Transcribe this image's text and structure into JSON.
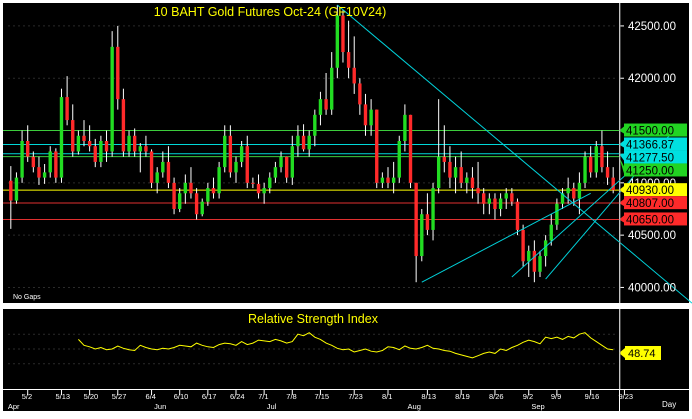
{
  "chart_data": [
    {
      "type": "candlestick",
      "title": "10 BAHT Gold Futures Oct-24 (GF10V24)",
      "note": "No Gaps",
      "y_ticks": [
        40000,
        40500,
        41000,
        41500,
        42000,
        42500
      ],
      "y_tick_labels": [
        "40000.00",
        "40500.00",
        "41000.00",
        "41500.00",
        "42000.00",
        "42500.00"
      ],
      "ylim": [
        39880,
        42700
      ],
      "x_tick_labels": [
        "5/2",
        "5/13",
        "5/20",
        "5/27",
        "6/4",
        "6/10",
        "6/17",
        "6/24",
        "7/1",
        "7/8",
        "7/15",
        "7/23",
        "8/1",
        "8/13",
        "8/19",
        "8/26",
        "9/2",
        "9/9",
        "9/16",
        "9/23"
      ],
      "month_labels": [
        "Apr",
        "Jun",
        "Jul",
        "Aug",
        "Sep"
      ],
      "axis_label": "Day",
      "horizontal_levels": [
        {
          "value": 41500,
          "label": "41500.00",
          "color": "#3ccc3c",
          "label_bg": "#22d422"
        },
        {
          "value": 41366.87,
          "label": "41366.87",
          "color": "#00d8d8",
          "label_bg": "#00e0e0"
        },
        {
          "value": 41277.5,
          "label": "41277.50",
          "color": "#00d8d8",
          "label_bg": "#00e0e0"
        },
        {
          "value": 41250,
          "label": "41250.00",
          "color": "#3ccc3c",
          "label_bg": "#22d422"
        },
        {
          "value": 40930,
          "label": "40930.00",
          "color": "#ffff00",
          "label_bg": "#ffff00"
        },
        {
          "value": 40807,
          "label": "40807.00",
          "color": "#e03030",
          "label_bg": "#ff2a2a"
        },
        {
          "value": 40650,
          "label": "40650.00",
          "color": "#e03030",
          "label_bg": "#ff2a2a"
        }
      ],
      "candles": [
        [
          41020,
          41160,
          40560,
          40830
        ],
        [
          40830,
          41100,
          40800,
          41050
        ],
        [
          41050,
          41500,
          41000,
          41400
        ],
        [
          41400,
          41550,
          41200,
          41250
        ],
        [
          41250,
          41300,
          41100,
          41150
        ],
        [
          41150,
          41250,
          40980,
          41050
        ],
        [
          41050,
          41180,
          40990,
          41100
        ],
        [
          41100,
          41350,
          41050,
          41300
        ],
        [
          41300,
          41330,
          41000,
          41050
        ],
        [
          41050,
          41900,
          41000,
          41820
        ],
        [
          41820,
          42020,
          41550,
          41600
        ],
        [
          41600,
          41750,
          41250,
          41300
        ],
        [
          41300,
          41500,
          41270,
          41450
        ],
        [
          41450,
          41600,
          41350,
          41400
        ],
        [
          41400,
          41550,
          41300,
          41350
        ],
        [
          41350,
          41420,
          41150,
          41200
        ],
        [
          41200,
          41450,
          41150,
          41400
        ],
        [
          41400,
          41500,
          41200,
          41300
        ],
        [
          41300,
          42450,
          41250,
          42300
        ],
        [
          42300,
          42500,
          41700,
          41800
        ],
        [
          41800,
          41900,
          41250,
          41300
        ],
        [
          41300,
          41500,
          41250,
          41450
        ],
        [
          41450,
          41520,
          41250,
          41300
        ],
        [
          41300,
          41380,
          41100,
          41350
        ],
        [
          41350,
          41450,
          41250,
          41300
        ],
        [
          41300,
          41320,
          40950,
          41000
        ],
        [
          41000,
          41150,
          40900,
          41100
        ],
        [
          41100,
          41300,
          41050,
          41200
        ],
        [
          41200,
          41350,
          40950,
          41000
        ],
        [
          41000,
          41050,
          40700,
          40750
        ],
        [
          40750,
          40950,
          40720,
          40900
        ],
        [
          40900,
          41080,
          40800,
          41000
        ],
        [
          41000,
          41150,
          40850,
          40900
        ],
        [
          40900,
          40950,
          40650,
          40700
        ],
        [
          40700,
          40850,
          40680,
          40820
        ],
        [
          40820,
          41000,
          40780,
          40950
        ],
        [
          40950,
          41050,
          40850,
          40900
        ],
        [
          40900,
          41200,
          40850,
          41150
        ],
        [
          41150,
          41550,
          41100,
          41450
        ],
        [
          41450,
          41550,
          41050,
          41100
        ],
        [
          41100,
          41250,
          41000,
          41200
        ],
        [
          41200,
          41400,
          41150,
          41350
        ],
        [
          41350,
          41450,
          40950,
          41000
        ],
        [
          41000,
          41050,
          40950,
          40990
        ],
        [
          40990,
          41080,
          40850,
          40900
        ],
        [
          40900,
          41000,
          40800,
          40950
        ],
        [
          40950,
          41100,
          40900,
          41050
        ],
        [
          41050,
          41200,
          41000,
          41150
        ],
        [
          41150,
          41300,
          41100,
          41250
        ],
        [
          41250,
          41250,
          41000,
          41050
        ],
        [
          41050,
          41450,
          40980,
          41350
        ],
        [
          41350,
          41550,
          41250,
          41450
        ],
        [
          41450,
          41560,
          41300,
          41320
        ],
        [
          41320,
          41500,
          41250,
          41450
        ],
        [
          41450,
          41700,
          41350,
          41650
        ],
        [
          41650,
          41870,
          41550,
          41800
        ],
        [
          41800,
          42050,
          41650,
          41700
        ],
        [
          41700,
          42250,
          41650,
          42100
        ],
        [
          42100,
          42700,
          42000,
          42600
        ],
        [
          42600,
          42650,
          42150,
          42250
        ],
        [
          42250,
          42550,
          42000,
          42100
        ],
        [
          42100,
          42400,
          41850,
          41950
        ],
        [
          41950,
          42000,
          41650,
          41750
        ],
        [
          41750,
          41850,
          41450,
          41550
        ],
        [
          41550,
          41800,
          41450,
          41700
        ],
        [
          41700,
          41700,
          40950,
          41000
        ],
        [
          41000,
          41100,
          40950,
          41050
        ],
        [
          41050,
          41150,
          40950,
          41000
        ],
        [
          41000,
          41200,
          40900,
          41050
        ],
        [
          41050,
          41450,
          41000,
          41400
        ],
        [
          41400,
          41750,
          41300,
          41650
        ],
        [
          41650,
          41650,
          40950,
          41000
        ],
        [
          41000,
          41000,
          40050,
          40300
        ],
        [
          40300,
          40750,
          40250,
          40700
        ],
        [
          40700,
          40900,
          40500,
          40550
        ],
        [
          40550,
          41000,
          40450,
          40950
        ],
        [
          40950,
          41800,
          40900,
          41250
        ],
        [
          41250,
          41550,
          41100,
          41200
        ],
        [
          41200,
          41350,
          40950,
          41050
        ],
        [
          41050,
          41250,
          40900,
          41150
        ],
        [
          41150,
          41300,
          40950,
          41000
        ],
        [
          41000,
          41100,
          40900,
          41050
        ],
        [
          41050,
          41150,
          40850,
          40950
        ],
        [
          40950,
          41200,
          40800,
          40900
        ],
        [
          40900,
          40950,
          40700,
          40800
        ],
        [
          40800,
          40900,
          40700,
          40850
        ],
        [
          40850,
          40900,
          40650,
          40750
        ],
        [
          40750,
          40900,
          40680,
          40850
        ],
        [
          40850,
          40950,
          40750,
          40900
        ],
        [
          40900,
          40950,
          40780,
          40820
        ],
        [
          40820,
          40850,
          40500,
          40550
        ],
        [
          40550,
          40600,
          40200,
          40250
        ],
        [
          40250,
          40400,
          40100,
          40350
        ],
        [
          40350,
          40450,
          40050,
          40150
        ],
        [
          40150,
          40350,
          40100,
          40300
        ],
        [
          40300,
          40500,
          40200,
          40450
        ],
        [
          40450,
          40700,
          40400,
          40600
        ],
        [
          40600,
          40850,
          40550,
          40800
        ],
        [
          40800,
          40950,
          40750,
          40900
        ],
        [
          40900,
          41050,
          40800,
          40950
        ],
        [
          40950,
          41000,
          40780,
          40850
        ],
        [
          40850,
          41100,
          40700,
          41000
        ],
        [
          41000,
          41300,
          40950,
          41250
        ],
        [
          41250,
          41350,
          41050,
          41100
        ],
        [
          41100,
          41400,
          41050,
          41350
        ],
        [
          41350,
          41500,
          41100,
          41150
        ],
        [
          41150,
          41300,
          40980,
          41050
        ],
        [
          41050,
          41150,
          40900,
          40930
        ]
      ],
      "trendlines": [
        {
          "from": [
            58,
            42700
          ],
          "to": [
            121,
            39850
          ]
        },
        {
          "from": [
            73,
            40050
          ],
          "to": [
            103,
            40900
          ]
        },
        {
          "from": [
            95,
            40080
          ],
          "to": [
            116,
            41400
          ]
        },
        {
          "from": [
            89,
            40100
          ],
          "to": [
            117,
            41450
          ]
        }
      ],
      "colors": {
        "up": "#22dd22",
        "down": "#ff2a2a",
        "wick": "#ffffff",
        "trendline": "#00d0d8"
      }
    },
    {
      "type": "line",
      "title": "Relative Strength Index",
      "last_value_label": "48.74",
      "ylim": [
        0,
        100
      ],
      "values": [
        63,
        55,
        53,
        50,
        52,
        49,
        50,
        54,
        51,
        49,
        48,
        55,
        52,
        50,
        49,
        51,
        50,
        52,
        55,
        54,
        53,
        58,
        55,
        53,
        52,
        56,
        58,
        57,
        55,
        60,
        56,
        58,
        62,
        61,
        60,
        63,
        61,
        58,
        60,
        70,
        68,
        72,
        66,
        63,
        58,
        55,
        51,
        49,
        50,
        46,
        48,
        50,
        47,
        46,
        48,
        53,
        52,
        49,
        54,
        51,
        50,
        52,
        55,
        51,
        50,
        48,
        47,
        44,
        42,
        40,
        38,
        41,
        44,
        46,
        44,
        50,
        48,
        52,
        55,
        59,
        62,
        60,
        57,
        66,
        64,
        66,
        63,
        67,
        65,
        70,
        72,
        65,
        60,
        55,
        50,
        49
      ],
      "color": "#ffff00"
    }
  ]
}
